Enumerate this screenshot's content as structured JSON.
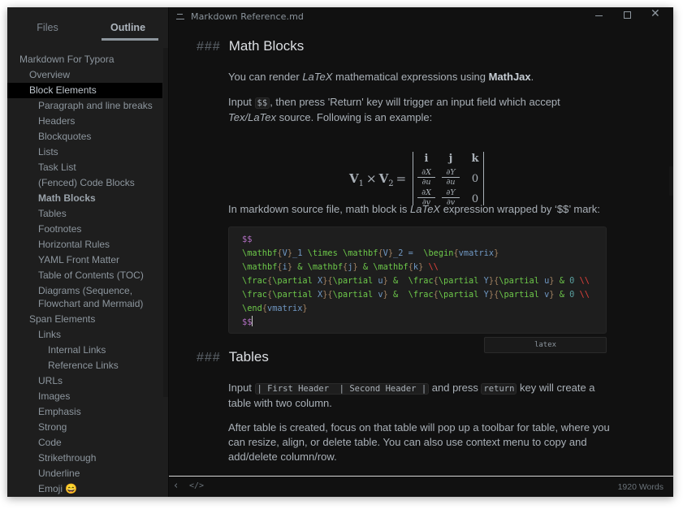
{
  "window": {
    "title": "Markdown Reference.md",
    "controls": {
      "minimize": "minimize",
      "maximize": "maximize",
      "close": "close"
    }
  },
  "sidebar": {
    "tabs": [
      {
        "label": "Files",
        "active": false
      },
      {
        "label": "Outline",
        "active": true
      }
    ],
    "outline": [
      {
        "label": "Markdown For Typora",
        "level": 1
      },
      {
        "label": "Overview",
        "level": 2
      },
      {
        "label": "Block Elements",
        "level": 2,
        "active": true
      },
      {
        "label": "Paragraph and line breaks",
        "level": 3
      },
      {
        "label": "Headers",
        "level": 3
      },
      {
        "label": "Blockquotes",
        "level": 3
      },
      {
        "label": "Lists",
        "level": 3
      },
      {
        "label": "Task List",
        "level": 3
      },
      {
        "label": "(Fenced) Code Blocks",
        "level": 3
      },
      {
        "label": "Math Blocks",
        "level": 3,
        "bold": true
      },
      {
        "label": "Tables",
        "level": 3
      },
      {
        "label": "Footnotes",
        "level": 3
      },
      {
        "label": "Horizontal Rules",
        "level": 3
      },
      {
        "label": "YAML Front Matter",
        "level": 3
      },
      {
        "label": "Table of Contents (TOC)",
        "level": 3
      },
      {
        "label": "Diagrams (Sequence, Flowchart and Mermaid)",
        "level": 3,
        "wrap": true
      },
      {
        "label": "Span Elements",
        "level": 2
      },
      {
        "label": "Links",
        "level": 3
      },
      {
        "label": "Internal Links",
        "level": 4
      },
      {
        "label": "Reference Links",
        "level": 4
      },
      {
        "label": "URLs",
        "level": 3
      },
      {
        "label": "Images",
        "level": 3
      },
      {
        "label": "Emphasis",
        "level": 3
      },
      {
        "label": "Strong",
        "level": 3
      },
      {
        "label": "Code",
        "level": 3
      },
      {
        "label": "Strikethrough",
        "level": 3
      },
      {
        "label": "Underline",
        "level": 3
      },
      {
        "label": "Emoji 😄",
        "level": 3
      }
    ]
  },
  "document": {
    "math_section": {
      "hash": "###",
      "heading": "Math Blocks",
      "p1": {
        "a": "You can render ",
        "em": "LaTeX",
        "b": " mathematical expressions using ",
        "strong": "MathJax",
        "c": "."
      },
      "p2": {
        "a": "Input ",
        "code": "$$",
        "b": ", then press 'Return' key will trigger an input field which accept ",
        "em": "Tex/LaTex",
        "c": " source. Following is an example:"
      },
      "formula": {
        "lhs_v": "V",
        "lhs_sub1": "1",
        "times": "×",
        "lhs_sub2": "2",
        "eq": "=",
        "row1": [
          "i",
          "j",
          "k"
        ],
        "row2": [
          {
            "num": "∂X",
            "den": "∂u"
          },
          {
            "num": "∂Y",
            "den": "∂u"
          },
          "0"
        ],
        "row3": [
          {
            "num": "∂X",
            "den": "∂v"
          },
          {
            "num": "∂Y",
            "den": "∂v"
          },
          "0"
        ]
      },
      "p3": {
        "a": "In markdown source file, math block is ",
        "em": "LaTeX",
        "b": " expression wrapped by ‘$$’ mark:"
      },
      "code_lines": [
        "$$",
        "\\mathbf{V}_1 \\times \\mathbf{V}_2 =  \\begin{vmatrix}",
        "\\mathbf{i} & \\mathbf{j} & \\mathbf{k} \\\\",
        "\\frac{\\partial X}{\\partial u} &  \\frac{\\partial Y}{\\partial u} & 0 \\\\",
        "\\frac{\\partial X}{\\partial v} &  \\frac{\\partial Y}{\\partial v} & 0 \\\\",
        "\\end{vmatrix}",
        "$$"
      ],
      "code_language": "latex"
    },
    "tables_section": {
      "hash": "###",
      "heading": "Tables",
      "p1": {
        "a": "Input ",
        "code1": "| First Header  | Second Header |",
        "b": " and press ",
        "code2": "return",
        "c": " key will create a table with two column."
      },
      "p2": "After table is created, focus on that table will pop up a toolbar for table, where you can resize, align, or delete table. You can also use context menu to copy and add/delete column/row."
    }
  },
  "footer": {
    "back_icon": "chevron-left",
    "source_icon": "</>",
    "word_count": "1920 Words"
  },
  "colors": {
    "editor_bg": "#111111",
    "sidebar_bg": "#1e1e1e",
    "text": "#a9b0b7",
    "heading": "#dcdfe3",
    "code_bg": "#1e1e1e",
    "latex_command": "#6dc84a",
    "latex_dollar": "#b16fc2",
    "latex_newline": "#e0403a"
  }
}
